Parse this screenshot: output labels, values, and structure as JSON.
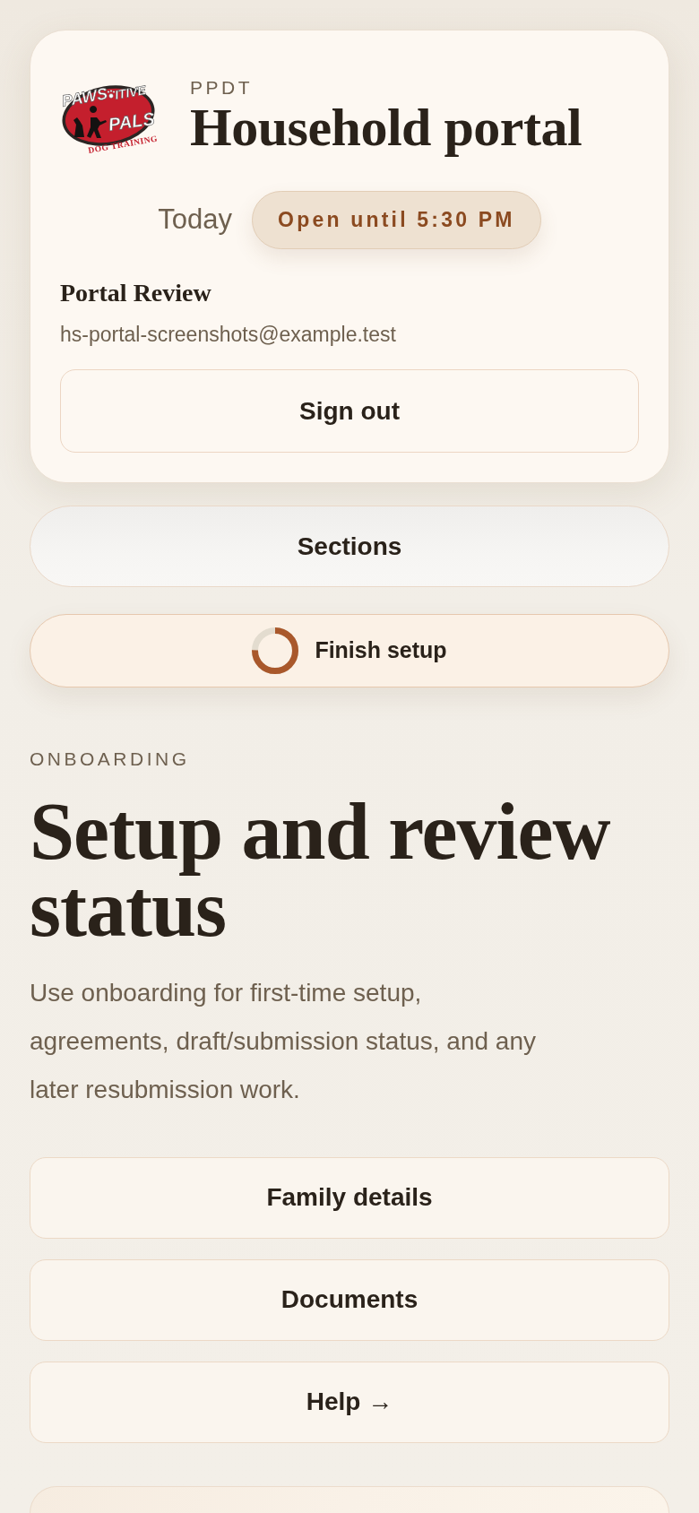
{
  "header": {
    "logo": {
      "words": [
        "PAWS",
        "ITIVE",
        "PALS"
      ],
      "tagline": "DOG TRAINING"
    },
    "eyebrow": "PPDT",
    "title": "Household portal",
    "today_label": "Today",
    "hours_badge": "Open until 5:30 PM",
    "user_name": "Portal Review",
    "user_email": "hs-portal-screenshots@example.test",
    "sign_out_button": "Sign out"
  },
  "sections_button": {
    "label": "Sections"
  },
  "setup_button": {
    "label": "Finish setup",
    "level": 0.75
  },
  "onboarding": {
    "eyebrow": "ONBOARDING",
    "title": "Setup and review status",
    "description": "Use onboarding for first-time setup, agreements, draft/submission status, and any later resubmission work.",
    "links": [
      {
        "label": "Family details"
      },
      {
        "label": "Documents"
      },
      {
        "label": "Help →"
      }
    ]
  }
}
